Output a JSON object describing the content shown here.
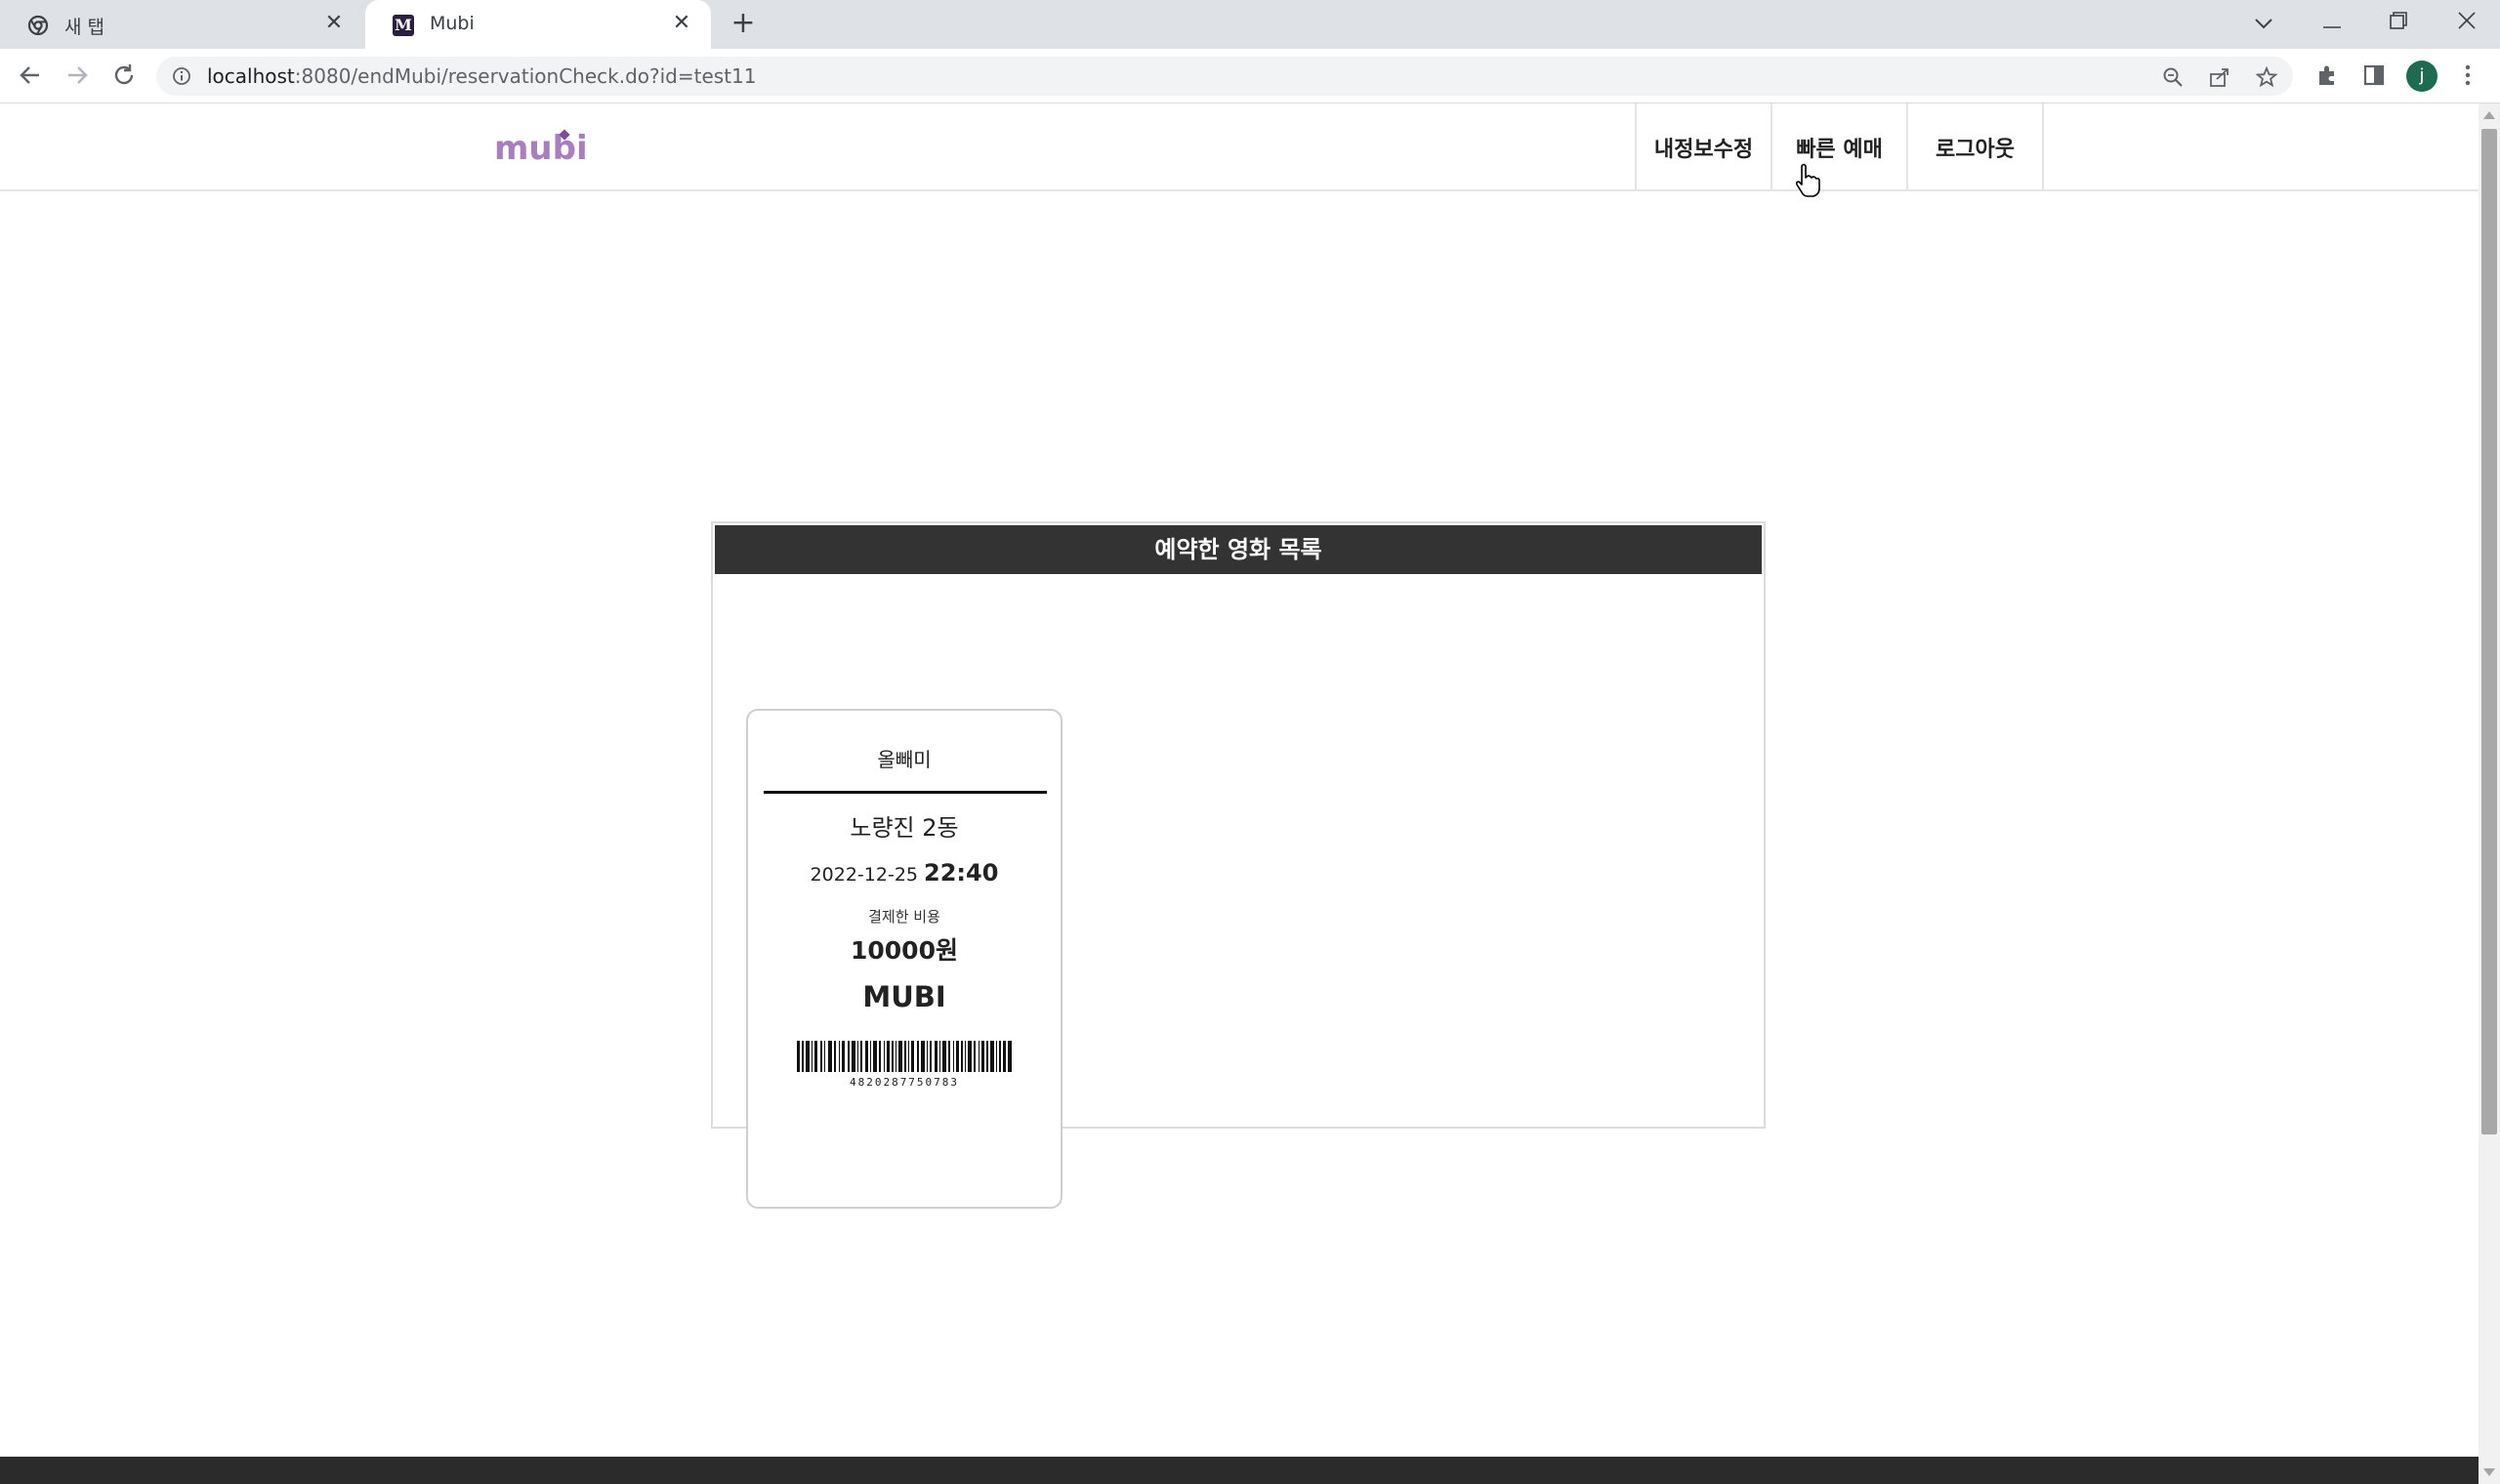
{
  "browser": {
    "tabs": [
      {
        "title": "새 탭",
        "active": false,
        "icon": "chrome-icon"
      },
      {
        "title": "Mubi",
        "active": true,
        "icon": "mubi-favicon"
      }
    ],
    "favicon_letter": "M",
    "url_host": "localhost",
    "url_rest": ":8080/endMubi/reservationCheck.do?id=test11",
    "profile_initial": "j"
  },
  "site": {
    "logo": "mubi",
    "brand_color": "#a77fbf",
    "nav": [
      {
        "label": "내정보수정"
      },
      {
        "label": "빠른 예매"
      },
      {
        "label": "로그아웃"
      }
    ]
  },
  "panel": {
    "title": "예약한 영화 목록",
    "header_color": "#333333",
    "tickets": [
      {
        "movie": "올빼미",
        "theater": "노량진 2동",
        "date": "2022-12-25",
        "time": "22:40",
        "price_label": "결제한 비용",
        "price": "10000원",
        "brand": "MUBI",
        "barcode_number": "4820287750783"
      }
    ]
  }
}
